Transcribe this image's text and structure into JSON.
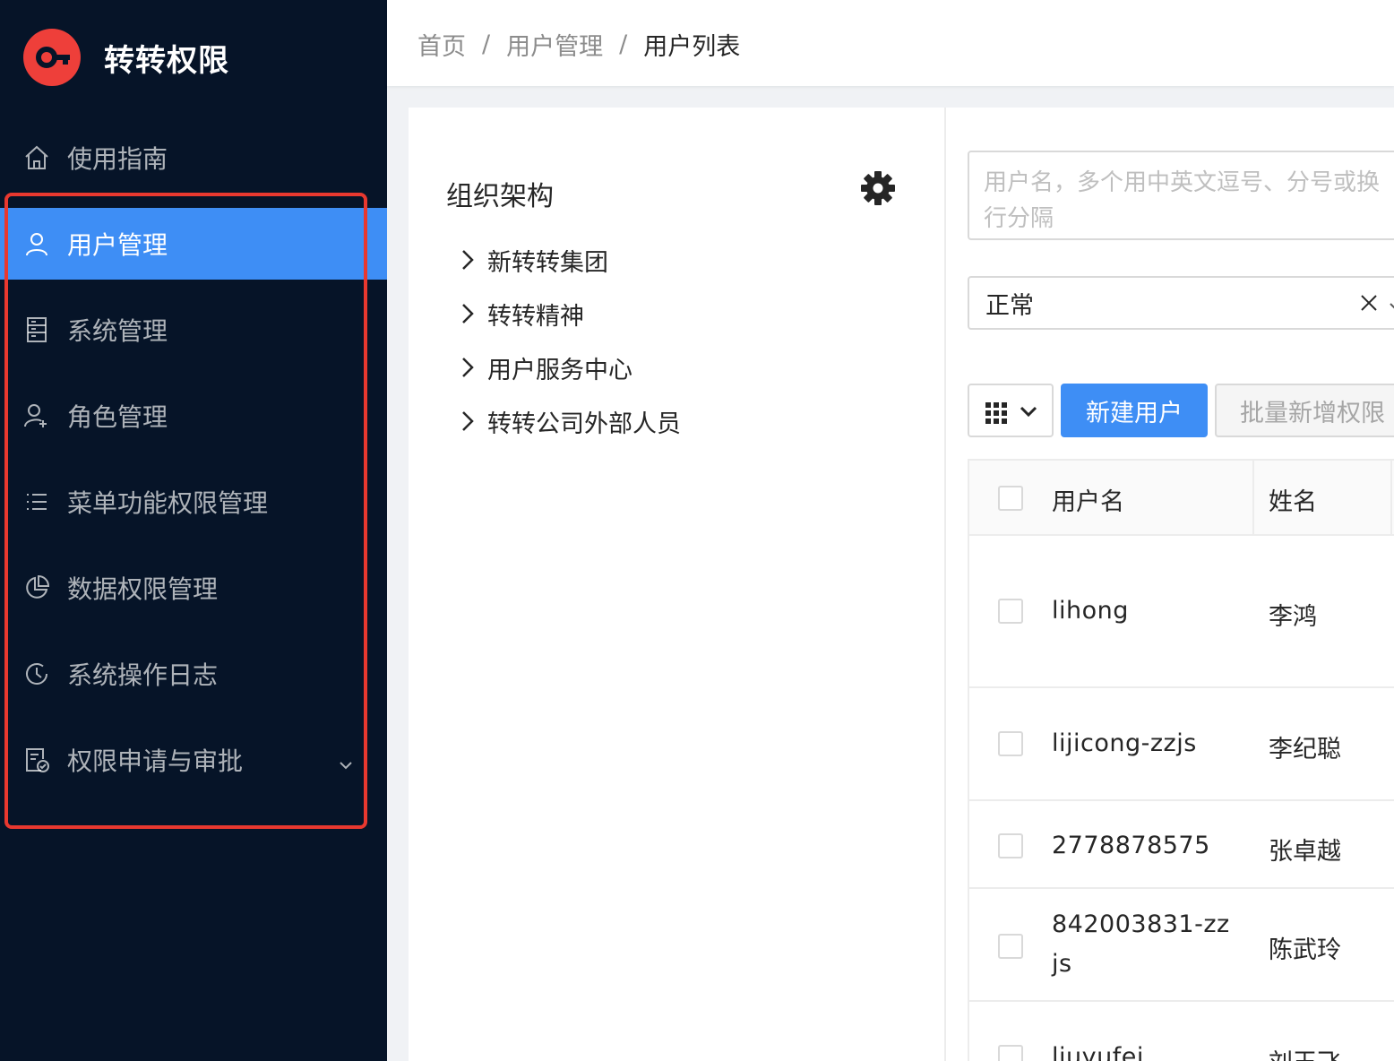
{
  "app": {
    "title": "转转权限"
  },
  "sidebar": {
    "items": [
      {
        "label": "使用指南",
        "icon": "home-icon"
      },
      {
        "label": "用户管理",
        "icon": "user-icon",
        "active": true
      },
      {
        "label": "系统管理",
        "icon": "server-icon"
      },
      {
        "label": "角色管理",
        "icon": "user-add-icon"
      },
      {
        "label": "菜单功能权限管理",
        "icon": "list-icon"
      },
      {
        "label": "数据权限管理",
        "icon": "pie-chart-icon"
      },
      {
        "label": "系统操作日志",
        "icon": "clock-icon"
      },
      {
        "label": "权限申请与审批",
        "icon": "file-check-icon"
      }
    ]
  },
  "breadcrumb": {
    "home": "首页",
    "section": "用户管理",
    "current": "用户列表",
    "separator": "/"
  },
  "org": {
    "title": "组织架构",
    "tree": [
      "新转转集团",
      "转转精神",
      "用户服务中心",
      "转转公司外部人员"
    ]
  },
  "filters": {
    "username_placeholder": "用户名，多个用中英文逗号、分号或换行分隔",
    "status_value": "正常"
  },
  "toolbar": {
    "new_user": "新建用户",
    "batch_add": "批量新增权限"
  },
  "table": {
    "columns": [
      "用户名",
      "姓名"
    ],
    "rows": [
      {
        "username": "lihong",
        "name": "李鸿"
      },
      {
        "username": "lijicong-zzjs",
        "name": "李纪聪"
      },
      {
        "username": "2778878575",
        "name": "张卓越"
      },
      {
        "username": "842003831-zzjs",
        "name": "陈武玲"
      },
      {
        "username": "liuyufei",
        "name": "刘玉飞"
      }
    ]
  },
  "colors": {
    "sidebar_bg": "#061428",
    "primary": "#3e8ef5",
    "logo": "#ee3f3a",
    "highlight": "#e8382f"
  }
}
